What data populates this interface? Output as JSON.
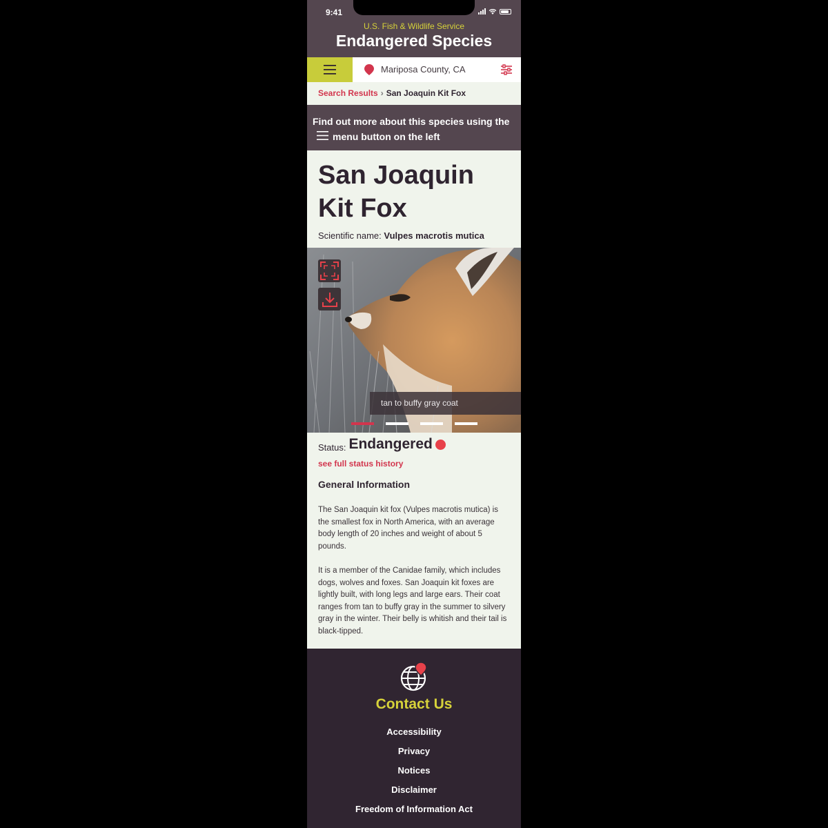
{
  "status_bar": {
    "time": "9:41"
  },
  "header": {
    "agency": "U.S. Fish & Wildlife Service",
    "title": "Endangered Species"
  },
  "toolbar": {
    "location": "Mariposa County, CA",
    "menu_icon": "hamburger-icon",
    "location_icon": "map-pin-icon",
    "filter_icon": "sliders-icon"
  },
  "breadcrumb": {
    "parent": "Search Results",
    "separator": "›",
    "current": "San Joaquin Kit Fox"
  },
  "hint": {
    "before": "Find out more about this species using the",
    "after": "menu button on the left"
  },
  "species": {
    "name": "San Joaquin Kit Fox",
    "scientific_label": "Scientific name:",
    "scientific_name": "Vulpes macrotis mutica"
  },
  "gallery": {
    "caption": "tan to buffy gray coat",
    "fullscreen_icon": "fullscreen-icon",
    "download_icon": "download-icon",
    "slides": 4,
    "active_slide": 1
  },
  "status": {
    "label": "Status:",
    "value": "Endangered",
    "color": "#e8414a",
    "history_link": "see full status history"
  },
  "general_info": {
    "heading": "General Information",
    "paragraphs": [
      "The San Joaquin kit fox (Vulpes macrotis mutica) is the smallest fox in North America, with an average body length of 20 inches and weight of about 5 pounds.",
      "It is a member of the Canidae family, which includes dogs, wolves and foxes. San Joaquin kit foxes are lightly built, with long legs and large ears. Their coat ranges from tan to buffy gray in the summer to silvery gray in the winter. Their belly is whitish and their tail is black-tipped."
    ]
  },
  "footer": {
    "icon": "globe-pin-icon",
    "contact": "Contact Us",
    "links": [
      "Accessibility",
      "Privacy",
      "Notices",
      "Disclaimer",
      "Freedom of Information Act"
    ]
  },
  "colors": {
    "header_bg": "#54464f",
    "accent_yellow": "#d6d23a",
    "menu_green": "#c8cc3a",
    "link_red": "#d2354d",
    "footer_bg": "#302531",
    "page_bg": "#f0f4ec"
  }
}
